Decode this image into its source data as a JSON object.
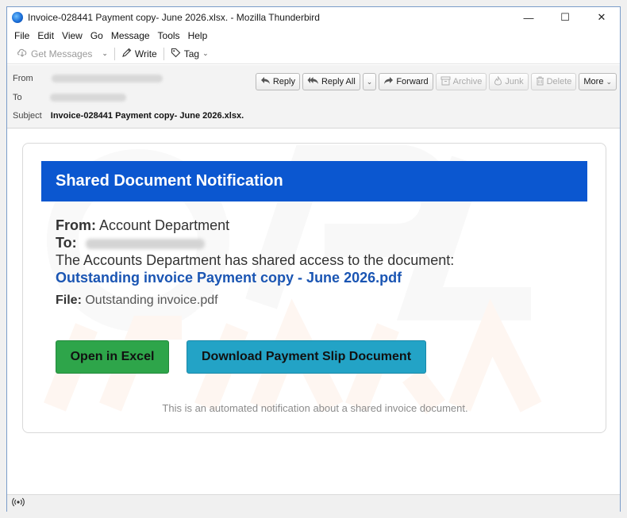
{
  "window": {
    "title": "Invoice-028441 Payment copy- June 2026.xlsx. - Mozilla Thunderbird",
    "controls": {
      "minimize": "—",
      "maximize": "☐",
      "close": "✕"
    }
  },
  "menu": [
    {
      "label": "File"
    },
    {
      "label": "Edit"
    },
    {
      "label": "View"
    },
    {
      "label": "Go"
    },
    {
      "label": "Message"
    },
    {
      "label": "Tools"
    },
    {
      "label": "Help"
    }
  ],
  "toolbar": {
    "get_messages": "Get Messages",
    "write": "Write",
    "tag": "Tag"
  },
  "header": {
    "from_label": "From",
    "to_label": "To",
    "subject_label": "Subject",
    "subject_value": "Invoice-028441 Payment copy- June 2026.xlsx.",
    "actions": {
      "reply": "Reply",
      "reply_all": "Reply All",
      "forward": "Forward",
      "archive": "Archive",
      "junk": "Junk",
      "delete": "Delete",
      "more": "More"
    }
  },
  "email": {
    "banner_title": "Shared Document Notification",
    "from_label": "From:",
    "from_value": "Account Department",
    "to_label": "To:",
    "shared_text": "The Accounts Department has shared access to the document:",
    "document_link": "Outstanding invoice Payment copy - June 2026.pdf",
    "file_label": "File:",
    "file_value": "Outstanding invoice.pdf",
    "open_button": "Open in Excel",
    "download_button": "Download Payment Slip Document",
    "footer_note": "This is an automated notification about a shared invoice document."
  },
  "colors": {
    "banner": "#0b57d0",
    "link": "#1a55b3",
    "open_button": "#2ea54a",
    "download_button": "#23a3c6"
  },
  "icons": {
    "app": "thunderbird-icon",
    "get_messages": "cloud-download-icon",
    "write": "pencil-icon",
    "tag": "tag-icon",
    "reply": "reply-arrow-icon",
    "reply_all": "reply-all-arrow-icon",
    "forward": "forward-arrow-icon",
    "archive": "archive-box-icon",
    "junk": "flame-icon",
    "delete": "trash-icon",
    "status": "radio-signal-icon"
  }
}
